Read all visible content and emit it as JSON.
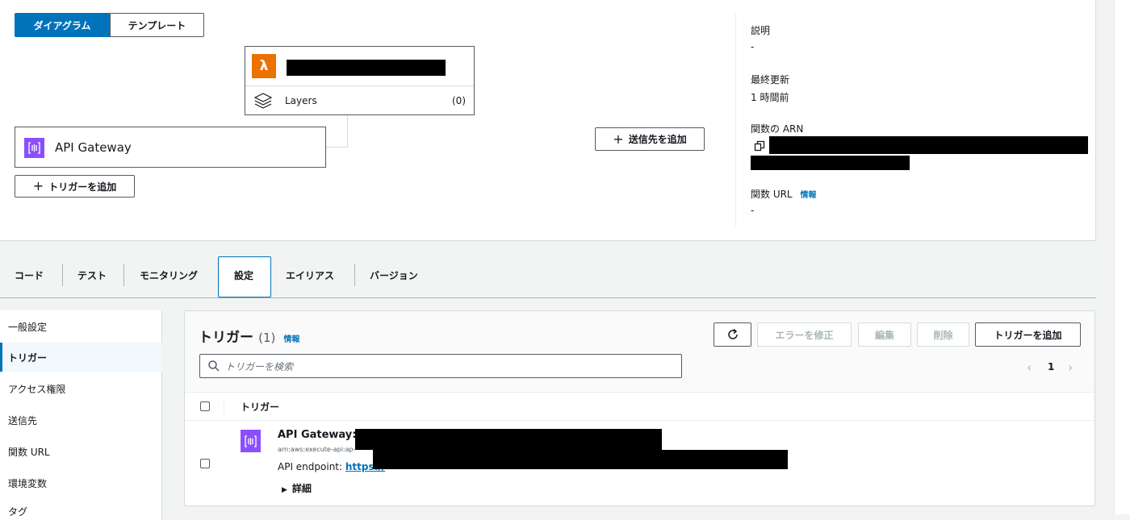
{
  "top": {
    "view_tabs": [
      "ダイアグラム",
      "テンプレート"
    ],
    "layers": {
      "label": "Layers",
      "count": "(0)"
    },
    "trigger_node": {
      "label": "API Gateway"
    },
    "add_trigger_label": "トリガーを追加",
    "add_destination_label": "送信先を追加",
    "plus_glyph": "+"
  },
  "meta": {
    "description_label": "説明",
    "description_value": "-",
    "last_modified_label": "最終更新",
    "last_modified_value": "1 時間前",
    "arn_label": "関数の ARN",
    "url_label": "関数 URL",
    "url_info": "情報",
    "url_value": "-"
  },
  "tabs": [
    "コード",
    "テスト",
    "モニタリング",
    "設定",
    "エイリアス",
    "バージョン"
  ],
  "active_tab": "設定",
  "sidebar": {
    "items": [
      "一般設定",
      "トリガー",
      "アクセス権限",
      "送信先",
      "関数 URL",
      "環境変数",
      "タグ"
    ],
    "active": "トリガー"
  },
  "triggers": {
    "title": "トリガー",
    "count": "(1)",
    "info": "情報",
    "fix_errors_label": "エラーを修正",
    "edit_label": "編集",
    "delete_label": "削除",
    "add_label": "トリガーを追加",
    "search_placeholder": "トリガーを検索",
    "page": "1",
    "column_header": "トリガー",
    "rows": [
      {
        "title": "API Gateway:",
        "arn_prefix": "arn:aws:execute-api:ap-",
        "endpoint_label": "API endpoint:",
        "endpoint_prefix": "https://",
        "details_label": "詳細"
      }
    ]
  },
  "colors": {
    "accent": "#0073bb",
    "lambda_orange": "#ed7100",
    "apigw_purple": "#8c4fff"
  }
}
